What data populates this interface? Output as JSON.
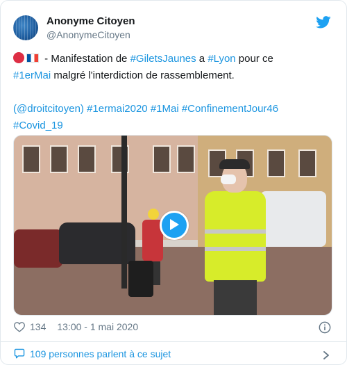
{
  "author": {
    "name": "Anonyme Citoyen",
    "handle": "@AnonymeCitoyen"
  },
  "tweet": {
    "line1_prefix": " - Manifestation de ",
    "line1_tag1": "#GiletsJaunes",
    "line1_mid": " a ",
    "line1_tag2": "#Lyon",
    "line1_suffix": " pour ce",
    "line2_tag": "#1erMai",
    "line2_suffix": " malgré l'interdiction de rassemblement.",
    "line3": "(@droitcitoyen) #1ermai2020 #1Mai #ConfinementJour46",
    "line4": "#Covid_19"
  },
  "stats": {
    "likes": "134",
    "timestamp": "13:00 - 1 mai 2020"
  },
  "footer": {
    "talking_label": "109 personnes parlent à ce sujet"
  },
  "icons": {
    "bird": "twitter-bird-icon",
    "heart": "heart-icon",
    "info": "info-icon",
    "chat": "chat-bubble-icon",
    "chevron": "chevron-right-icon",
    "play": "play-icon"
  },
  "colors": {
    "brand": "#1da1f2",
    "link": "#1b95e0",
    "muted": "#657786"
  }
}
